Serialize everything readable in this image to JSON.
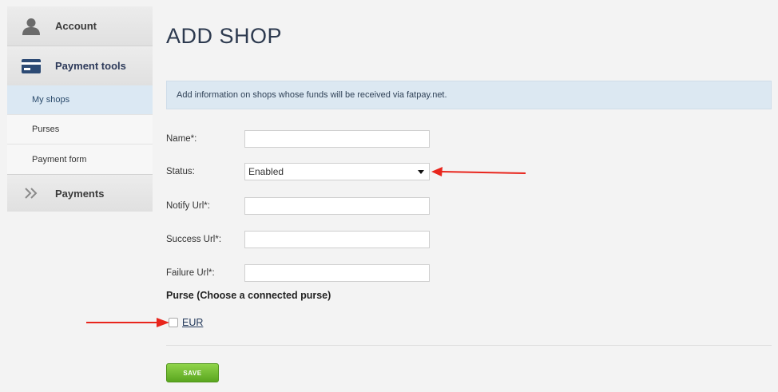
{
  "sidebar": {
    "account": {
      "label": "Account",
      "icon": "user-icon"
    },
    "payment_tools": {
      "label": "Payment tools",
      "icon": "credit-card-icon",
      "items": [
        {
          "label": "My shops",
          "active": true
        },
        {
          "label": "Purses",
          "active": false
        },
        {
          "label": "Payment form",
          "active": false
        }
      ]
    },
    "payments": {
      "label": "Payments",
      "icon": "double-chevron-right-icon"
    }
  },
  "page": {
    "title": "ADD SHOP",
    "info": "Add information on shops whose funds will be received via fatpay.net."
  },
  "form": {
    "name": {
      "label": "Name*:",
      "value": ""
    },
    "status": {
      "label": "Status:",
      "value": "Enabled"
    },
    "notify_url": {
      "label": "Notify Url*:",
      "value": ""
    },
    "success_url": {
      "label": "Success Url*:",
      "value": ""
    },
    "failure_url": {
      "label": "Failure Url*:",
      "value": ""
    },
    "purse": {
      "heading": "Purse (Choose a connected purse)",
      "options": [
        {
          "label": "EUR",
          "checked": false
        }
      ]
    },
    "save_label": "SAVE"
  },
  "colors": {
    "accent_blue": "#dce8f2",
    "save_green": "#6cbb2a",
    "annotation_red": "#e8251c",
    "title": "#2d3a4f"
  }
}
